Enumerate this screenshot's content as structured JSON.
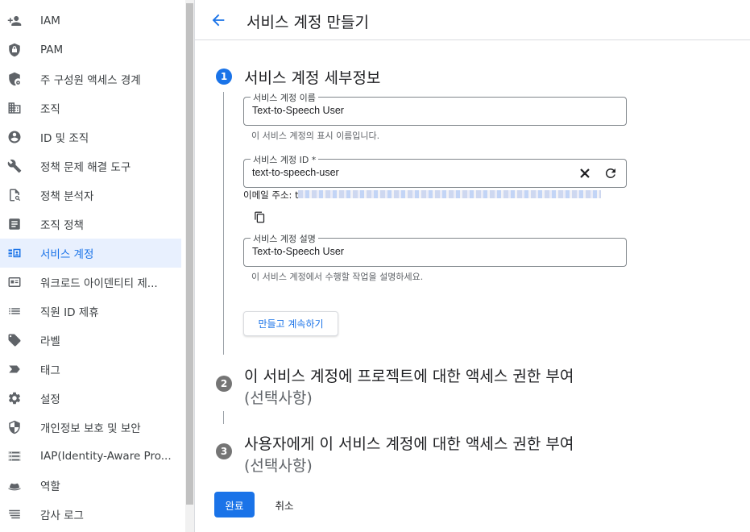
{
  "sidebar": {
    "items": [
      {
        "label": "IAM",
        "icon": "person-add-icon"
      },
      {
        "label": "PAM",
        "icon": "shield-lock-icon"
      },
      {
        "label": "주 구성원 액세스 경계",
        "icon": "shield-gear-icon"
      },
      {
        "label": "조직",
        "icon": "building-icon"
      },
      {
        "label": "ID 및 조직",
        "icon": "account-circle-icon"
      },
      {
        "label": "정책 문제 해결 도구",
        "icon": "wrench-icon"
      },
      {
        "label": "정책 분석자",
        "icon": "policy-search-icon"
      },
      {
        "label": "조직 정책",
        "icon": "document-icon"
      },
      {
        "label": "서비스 계정",
        "icon": "service-account-icon",
        "active": true
      },
      {
        "label": "워크로드 아이덴티티 제...",
        "icon": "id-card-icon"
      },
      {
        "label": "직원 ID 제휴",
        "icon": "list-icon"
      },
      {
        "label": "라벨",
        "icon": "label-icon"
      },
      {
        "label": "태그",
        "icon": "tag-arrow-icon"
      },
      {
        "label": "설정",
        "icon": "gear-icon"
      },
      {
        "label": "개인정보 보호 및 보안",
        "icon": "shield-icon"
      },
      {
        "label": "IAP(Identity-Aware Pro...",
        "icon": "iap-icon"
      },
      {
        "label": "역할",
        "icon": "hat-icon"
      },
      {
        "label": "감사 로그",
        "icon": "lines-icon"
      }
    ]
  },
  "header": {
    "title": "서비스 계정 만들기",
    "back_icon": "arrow-back-icon"
  },
  "steps": [
    {
      "number": "1",
      "title": "서비스 계정 세부정보",
      "state": "active"
    },
    {
      "number": "2",
      "title": "이 서비스 계정에 프로젝트에 대한 액세스 권한 부여",
      "optional": "(선택사항)",
      "state": "inactive"
    },
    {
      "number": "3",
      "title": "사용자에게 이 서비스 계정에 대한 액세스 권한 부여",
      "optional": "(선택사항)",
      "state": "inactive"
    }
  ],
  "form": {
    "name_field": {
      "label": "서비스 계정 이름",
      "value": "Text-to-Speech User",
      "hint": "이 서비스 계정의 표시 이름입니다."
    },
    "id_field": {
      "label": "서비스 계정 ID *",
      "value": "text-to-speech-user"
    },
    "email_prefix": "이메일 주소: t",
    "description_field": {
      "label": "서비스 계정 설명",
      "value": "Text-to-Speech User",
      "hint": "이 서비스 계정에서 수행할 작업을 설명하세요."
    },
    "continue_label": "만들고 계속하기"
  },
  "footer": {
    "done_label": "완료",
    "cancel_label": "취소"
  },
  "colors": {
    "accent": "#1a73e8",
    "active_bg": "#e8f0fe"
  }
}
